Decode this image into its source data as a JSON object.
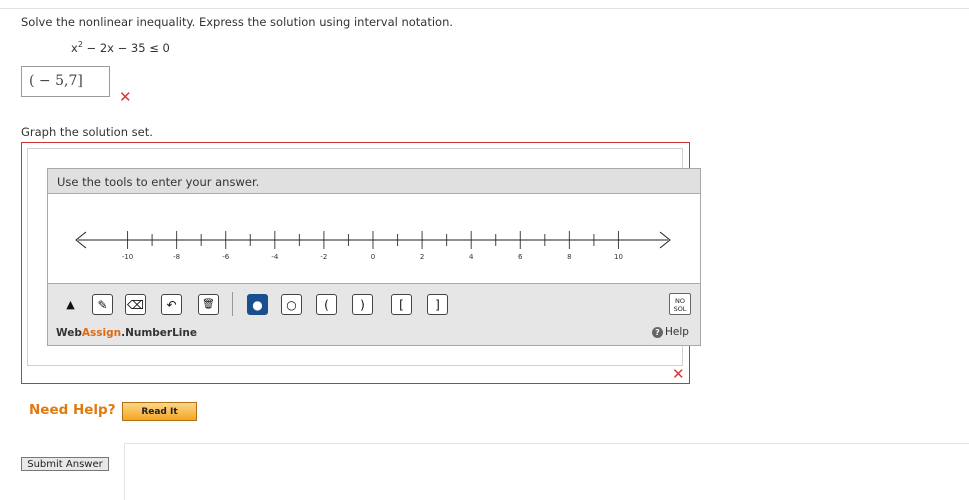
{
  "question": {
    "prompt": "Solve the nonlinear inequality. Express the solution using interval notation.",
    "inequality": {
      "lhs_base": "x",
      "lhs_exp": "2",
      "rest": " − 2x − 35 ≤ 0"
    },
    "answer_value": "( − 5,7]",
    "answer_status": "incorrect",
    "graph_label": "Graph the solution set."
  },
  "tool_panel": {
    "instruction": "Use the tools to enter your answer.",
    "number_line": {
      "min": -11,
      "max": 11,
      "tick_step": 1,
      "labels": [
        -10,
        -8,
        -6,
        -4,
        -2,
        0,
        2,
        4,
        6,
        8,
        10
      ]
    },
    "tools": [
      {
        "id": "pointer",
        "icon": "pointer-arrow-icon",
        "glyph": "▲"
      },
      {
        "id": "pencil",
        "icon": "pencil-icon",
        "glyph": "✎"
      },
      {
        "id": "eraser",
        "icon": "eraser-icon",
        "glyph": "⌫"
      },
      {
        "id": "undo",
        "icon": "undo-icon",
        "glyph": "↶"
      },
      {
        "id": "delete",
        "icon": "trash-icon",
        "glyph": "🗑"
      },
      {
        "id": "closed-point",
        "icon": "filled-circle-icon",
        "glyph": "●"
      },
      {
        "id": "open-point",
        "icon": "open-circle-icon",
        "glyph": "○"
      },
      {
        "id": "left-paren",
        "icon": "left-paren-icon",
        "glyph": "("
      },
      {
        "id": "right-paren",
        "icon": "right-paren-icon",
        "glyph": ")"
      },
      {
        "id": "left-bracket",
        "icon": "left-bracket-icon",
        "glyph": "["
      },
      {
        "id": "right-bracket",
        "icon": "right-bracket-icon",
        "glyph": "]"
      }
    ],
    "no_solution_line1": "NO",
    "no_solution_line2": "SOL",
    "brand_web": "Web",
    "brand_assign": "Assign",
    "brand_suffix": ".NumberLine",
    "help_label": "Help",
    "graph_status": "incorrect"
  },
  "help": {
    "need_help_label": "Need Help?",
    "read_it_label": "Read It"
  },
  "submit_label": "Submit Answer",
  "colors": {
    "error_red": "#d63838",
    "frame_red": "#cc3333",
    "help_orange": "#e07a10",
    "closed_point_blue": "#1a4f8f"
  }
}
